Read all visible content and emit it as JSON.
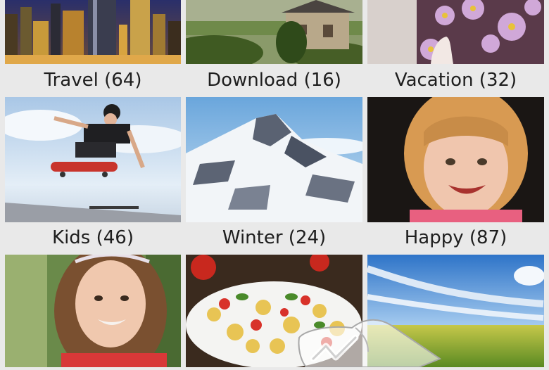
{
  "albums": [
    {
      "name": "Travel",
      "count": "(64)",
      "caption": "Travel (64)"
    },
    {
      "name": "Download",
      "count": "(16)",
      "caption": "Download (16)"
    },
    {
      "name": "Vacation",
      "count": "(32)",
      "caption": "Vacation (32)"
    },
    {
      "name": "Kids",
      "count": "(46)",
      "caption": "Kids (46)"
    },
    {
      "name": "Winter",
      "count": "(24)",
      "caption": "Winter (24)"
    },
    {
      "name": "Happy",
      "count": "(87)",
      "caption": "Happy (87)"
    },
    {
      "name": "Girl",
      "caption": ""
    },
    {
      "name": "Food",
      "caption": ""
    },
    {
      "name": "Field",
      "caption": ""
    }
  ],
  "colors": {
    "background": "#e9e9e9",
    "caption_text": "#1e1e1e"
  },
  "icons": {
    "gesture": "touch-hand-icon"
  }
}
